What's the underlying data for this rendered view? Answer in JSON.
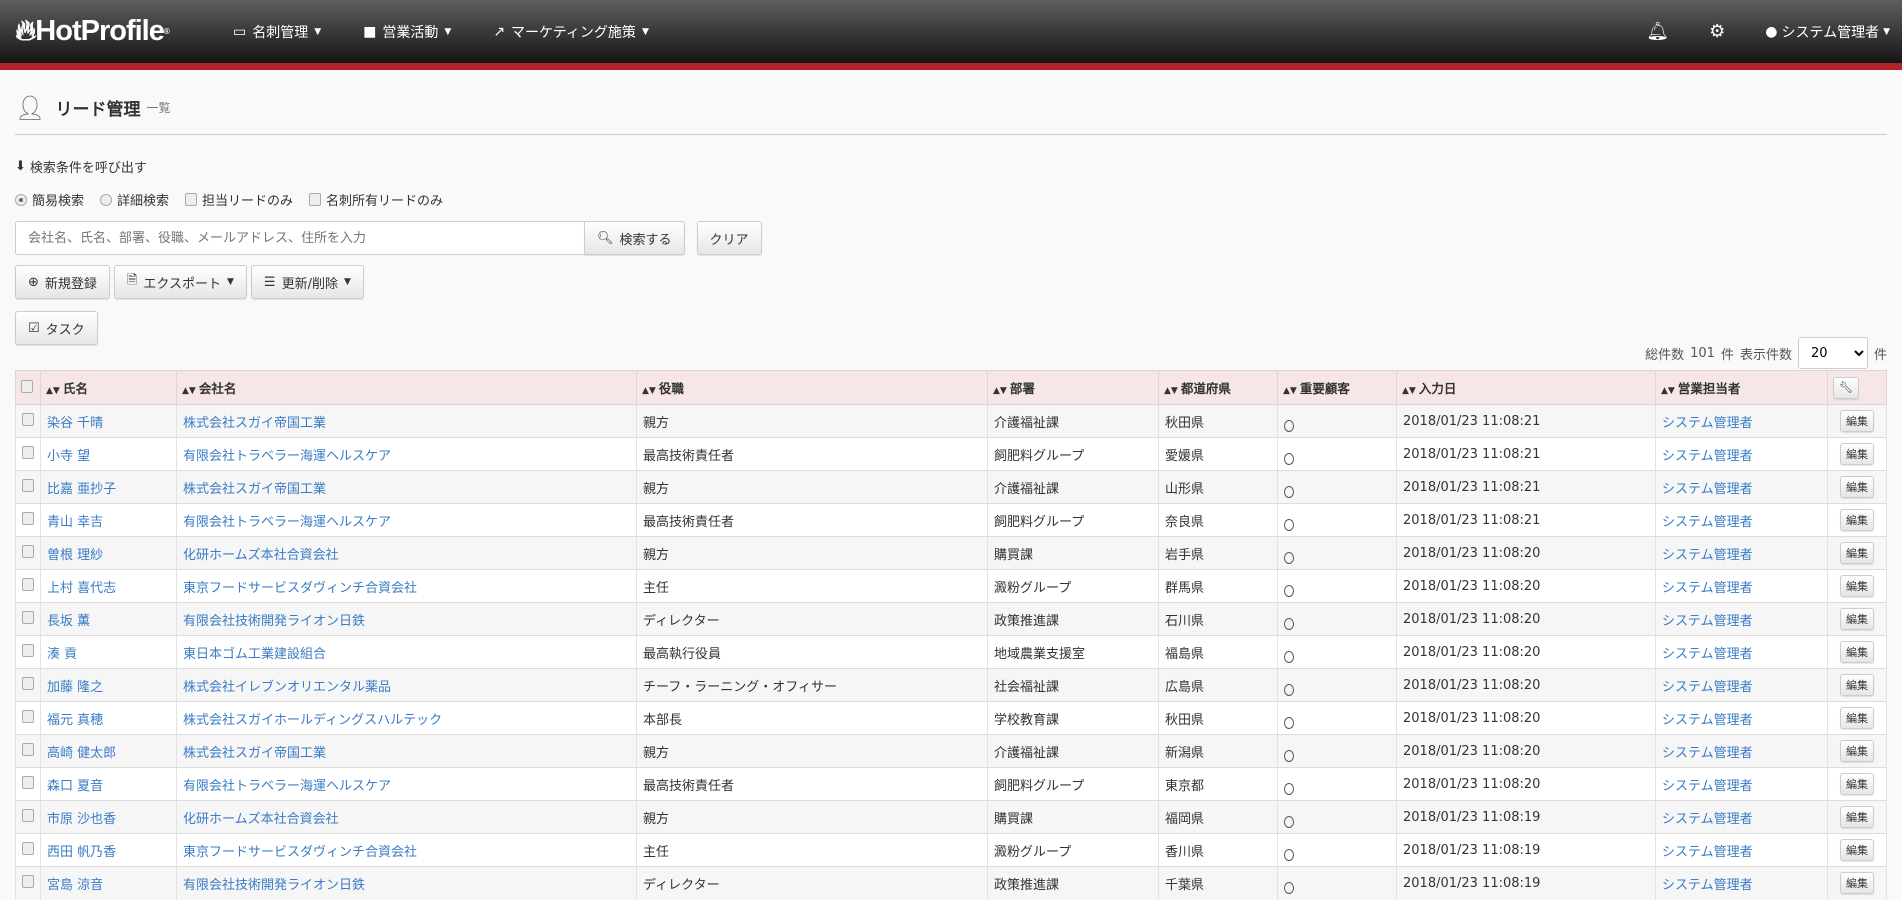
{
  "nav": {
    "logo": "HotProfile",
    "menu": [
      {
        "label": "名刺管理",
        "icon": "card-icon"
      },
      {
        "label": "営業活動",
        "icon": "briefcase-icon"
      },
      {
        "label": "マーケティング施策",
        "icon": "chart-icon"
      }
    ],
    "user": "システム管理者"
  },
  "page": {
    "title": "リード管理",
    "subtitle": "一覧"
  },
  "search": {
    "recall": "検索条件を呼び出す",
    "mode_simple": "簡易検索",
    "mode_detail": "詳細検索",
    "only_assigned": "担当リードのみ",
    "only_card_owner": "名刺所有リードのみ",
    "placeholder": "会社名、氏名、部署、役職、メールアドレス、住所を入力",
    "value": "",
    "search_button": "検索する",
    "clear_button": "クリア"
  },
  "actions": {
    "new": "新規登録",
    "export": "エクスポート",
    "update": "更新/削除",
    "task": "タスク"
  },
  "count": {
    "prefix": "総件数",
    "total": "101",
    "unit": "件",
    "per_page_label": "表示件数",
    "per_page": "20",
    "suffix": "件"
  },
  "table": {
    "headers": [
      "氏名",
      "会社名",
      "役職",
      "部署",
      "都道府県",
      "重要顧客",
      "入力日",
      "営業担当者"
    ],
    "edit_label": "編集",
    "rows": [
      [
        "染谷 千晴",
        "株式会社スガイ帝国工業",
        "親方",
        "介護福祉課",
        "秋田県",
        "〇",
        "2018/01/23 11:08:21",
        "システム管理者"
      ],
      [
        "小寺 望",
        "有限会社トラベラー海運ヘルスケア",
        "最高技術責任者",
        "飼肥料グループ",
        "愛媛県",
        "〇",
        "2018/01/23 11:08:21",
        "システム管理者"
      ],
      [
        "比嘉 亜抄子",
        "株式会社スガイ帝国工業",
        "親方",
        "介護福祉課",
        "山形県",
        "〇",
        "2018/01/23 11:08:21",
        "システム管理者"
      ],
      [
        "青山 幸吉",
        "有限会社トラベラー海運ヘルスケア",
        "最高技術責任者",
        "飼肥料グループ",
        "奈良県",
        "〇",
        "2018/01/23 11:08:21",
        "システム管理者"
      ],
      [
        "曽根 理紗",
        "化研ホームズ本社合資会社",
        "親方",
        "購買課",
        "岩手県",
        "〇",
        "2018/01/23 11:08:20",
        "システム管理者"
      ],
      [
        "上村 喜代志",
        "東京フードサービスダヴィンチ合資会社",
        "主任",
        "澱粉グループ",
        "群馬県",
        "〇",
        "2018/01/23 11:08:20",
        "システム管理者"
      ],
      [
        "長坂 薫",
        "有限会社技術開発ライオン日鉄",
        "ディレクター",
        "政策推進課",
        "石川県",
        "〇",
        "2018/01/23 11:08:20",
        "システム管理者"
      ],
      [
        "湊 貢",
        "東日本ゴム工業建設組合",
        "最高執行役員",
        "地域農業支援室",
        "福島県",
        "〇",
        "2018/01/23 11:08:20",
        "システム管理者"
      ],
      [
        "加藤 隆之",
        "株式会社イレブンオリエンタル薬品",
        "チーフ・ラーニング・オフィサー",
        "社会福祉課",
        "広島県",
        "〇",
        "2018/01/23 11:08:20",
        "システム管理者"
      ],
      [
        "福元 真穂",
        "株式会社スガイホールディングスハルテック",
        "本部長",
        "学校教育課",
        "秋田県",
        "〇",
        "2018/01/23 11:08:20",
        "システム管理者"
      ],
      [
        "高崎 健太郎",
        "株式会社スガイ帝国工業",
        "親方",
        "介護福祉課",
        "新潟県",
        "〇",
        "2018/01/23 11:08:20",
        "システム管理者"
      ],
      [
        "森口 夏音",
        "有限会社トラベラー海運ヘルスケア",
        "最高技術責任者",
        "飼肥料グループ",
        "東京都",
        "〇",
        "2018/01/23 11:08:20",
        "システム管理者"
      ],
      [
        "市原 沙也香",
        "化研ホームズ本社合資会社",
        "親方",
        "購買課",
        "福岡県",
        "〇",
        "2018/01/23 11:08:19",
        "システム管理者"
      ],
      [
        "西田 帆乃香",
        "東京フードサービスダヴィンチ合資会社",
        "主任",
        "澱粉グループ",
        "香川県",
        "〇",
        "2018/01/23 11:08:19",
        "システム管理者"
      ],
      [
        "宮島 涼音",
        "有限会社技術開発ライオン日鉄",
        "ディレクター",
        "政策推進課",
        "千葉県",
        "〇",
        "2018/01/23 11:08:19",
        "システム管理者"
      ]
    ]
  }
}
